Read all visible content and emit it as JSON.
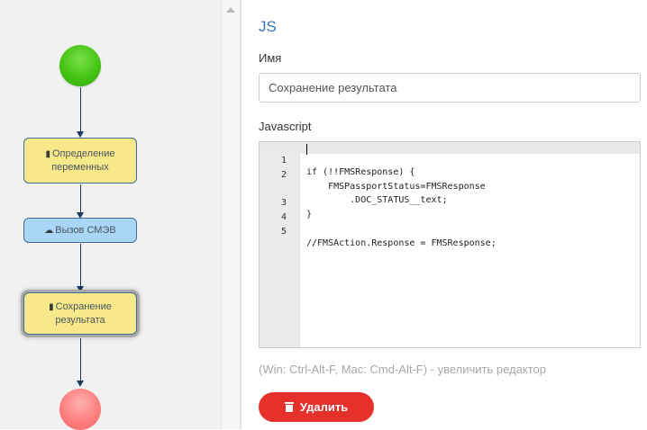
{
  "diagram": {
    "tasks": [
      {
        "icon": "book-icon",
        "label_line1": "Определение",
        "label_line2": "переменных"
      },
      {
        "icon": "cloud-icon",
        "label_line1": "Вызов СМЭВ",
        "label_line2": ""
      },
      {
        "icon": "book-icon",
        "label_line1": "Сохранение",
        "label_line2": "результата"
      }
    ]
  },
  "panel": {
    "title": "JS",
    "name_label": "Имя",
    "name_value": "Сохранение результата",
    "code_label": "Javascript",
    "code_lines": [
      {
        "num": "1",
        "text": "if (!!FMSResponse) {"
      },
      {
        "num": "2",
        "text": "    FMSPassportStatus=FMSResponse"
      },
      {
        "num": "",
        "text": "        .DOC_STATUS__text;"
      },
      {
        "num": "3",
        "text": "}"
      },
      {
        "num": "4",
        "text": ""
      },
      {
        "num": "5",
        "text": "//FMSAction.Response = FMSResponse;"
      }
    ],
    "hint": "(Win: Ctrl-Alt-F, Mac: Cmd-Alt-F) - увеличить редактор",
    "delete_label": "Удалить"
  },
  "colors": {
    "accent_title": "#3b73b9",
    "delete_button": "#e5302b",
    "task_yellow": "#f7e889",
    "task_blue": "#a9d6f7",
    "start_event": "#45c414",
    "end_event": "#ff7f7f"
  }
}
